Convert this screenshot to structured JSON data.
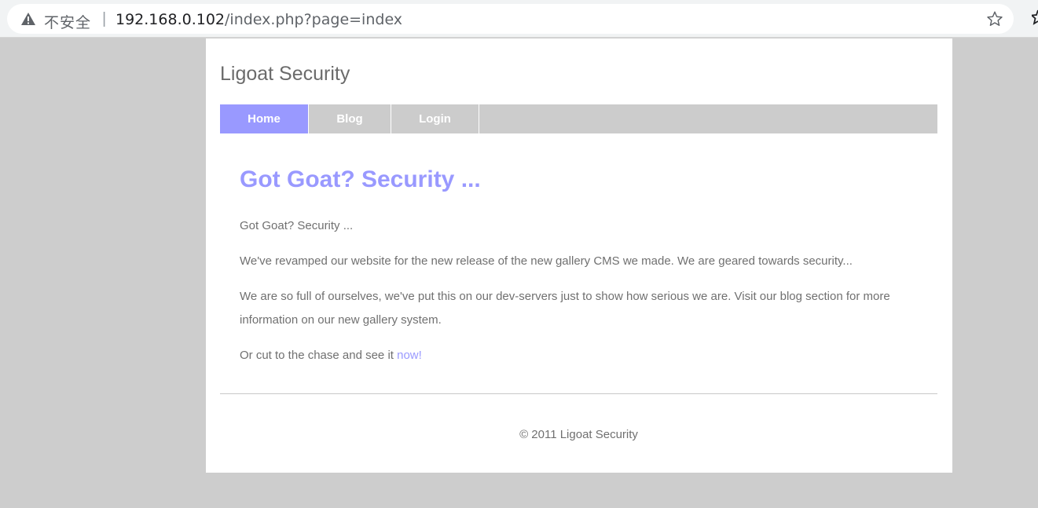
{
  "browser": {
    "security_label": "不安全",
    "separator": "|",
    "url_host": "192.168.0.102",
    "url_path": "/index.php?page=index",
    "icons": [
      "warning-icon",
      "bookmark-star-icon"
    ]
  },
  "site": {
    "title": "Ligoat Security",
    "nav": [
      {
        "label": "Home",
        "active": true
      },
      {
        "label": "Blog",
        "active": false
      },
      {
        "label": "Login",
        "active": false
      }
    ]
  },
  "main": {
    "heading": "Got Goat? Security ...",
    "paragraphs": [
      "Got Goat? Security ...",
      "We've revamped our website for the new release of the new gallery CMS we made. We are geared towards security...",
      "We are so full of ourselves, we've put this on our dev-servers just to show how serious we are. Visit our blog section for more information on our new gallery system."
    ],
    "cta_text": "Or cut to the chase and see it ",
    "cta_link": "now!"
  },
  "footer": {
    "copyright": "© 2011 Ligoat Security"
  },
  "colors": {
    "accent": "#9999ff",
    "nav_bg": "#cccccc",
    "page_bg": "#cdcdcd",
    "text": "#707070"
  }
}
